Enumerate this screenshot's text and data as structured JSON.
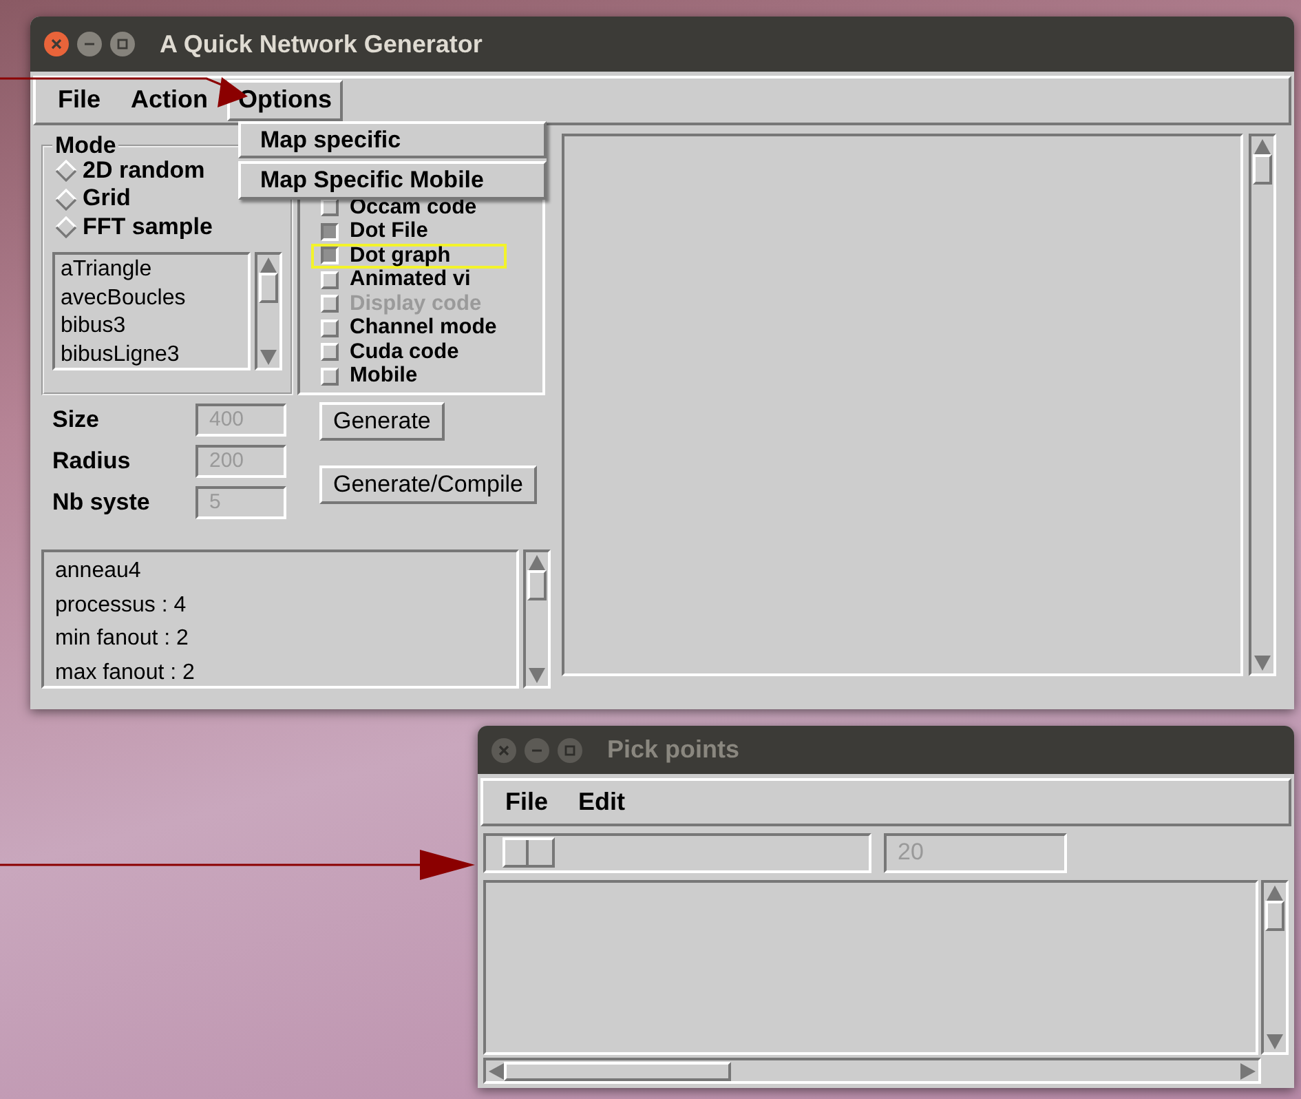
{
  "main_window": {
    "title": "A Quick Network Generator",
    "active": true,
    "menu": [
      {
        "label": "File",
        "selected": false
      },
      {
        "label": "Action",
        "selected": false
      },
      {
        "label": "Options",
        "selected": true
      }
    ],
    "options_menu": [
      "Map specific",
      "Map Specific Mobile"
    ],
    "mode": {
      "title": "Mode",
      "radios": [
        {
          "label": "2D random",
          "selected": false
        },
        {
          "label": "Grid",
          "selected": false
        },
        {
          "label": "FFT sample",
          "selected": false
        }
      ],
      "list": [
        "aTriangle",
        "avecBoucles",
        "bibus3",
        "bibusLigne3"
      ]
    },
    "checkboxes": [
      {
        "label": "Occam code",
        "checked": false,
        "disabled": false,
        "highlighted": false
      },
      {
        "label": "Dot File",
        "checked": true,
        "disabled": false,
        "highlighted": false
      },
      {
        "label": "Dot graph",
        "checked": true,
        "disabled": false,
        "highlighted": true
      },
      {
        "label": "Animated vi",
        "checked": false,
        "disabled": false,
        "highlighted": false
      },
      {
        "label": "Display code",
        "checked": false,
        "disabled": true,
        "highlighted": false
      },
      {
        "label": "Channel mode",
        "checked": false,
        "disabled": false,
        "highlighted": false
      },
      {
        "label": "Cuda code",
        "checked": false,
        "disabled": false,
        "highlighted": false
      },
      {
        "label": "Mobile",
        "checked": false,
        "disabled": false,
        "highlighted": false
      }
    ],
    "fields": [
      {
        "label": "Size",
        "value": "400",
        "disabled": true
      },
      {
        "label": "Radius",
        "value": "200",
        "disabled": true
      },
      {
        "label": "Nb syste",
        "value": "5",
        "disabled": true
      }
    ],
    "buttons": [
      "Generate",
      "Generate/Compile"
    ],
    "output": [
      "anneau4",
      "processus : 4",
      "min fanout : 2",
      "max fanout : 2"
    ]
  },
  "pick_window": {
    "title": "Pick points",
    "active": false,
    "menu": [
      {
        "label": "File",
        "selected": false
      },
      {
        "label": "Edit",
        "selected": false
      }
    ],
    "field": {
      "value": "20",
      "disabled": true
    }
  }
}
